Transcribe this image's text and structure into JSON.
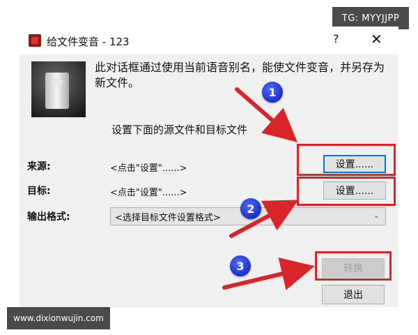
{
  "watermarks": {
    "top_right": "TG: MYYJJPP",
    "bottom_left": "www.dixionwujin.com"
  },
  "dialog": {
    "title": "给文件变音 - 123",
    "help_label": "?",
    "close_label": "✕",
    "description": "此对话框通过使用当前语音别名，能使文件变音，并另存为新文件。",
    "section_caption": "设置下面的源文件和目标文件",
    "source_label": "来源:",
    "source_value": "<点击\"设置\"......>",
    "source_button": "设置......",
    "target_label": "目标:",
    "target_value": "<点击\"设置\"......>",
    "target_button": "设置......",
    "format_label": "输出格式:",
    "format_selected": "<选择目标文件设置格式>",
    "convert_button": "转换",
    "exit_button": "退出"
  },
  "annotations": {
    "badge_1": "1",
    "badge_2": "2",
    "badge_3": "3"
  },
  "colors": {
    "highlight_red": "#d9252a",
    "badge_blue": "#1b2fc8",
    "dialog_bg": "#f0f0f0"
  }
}
